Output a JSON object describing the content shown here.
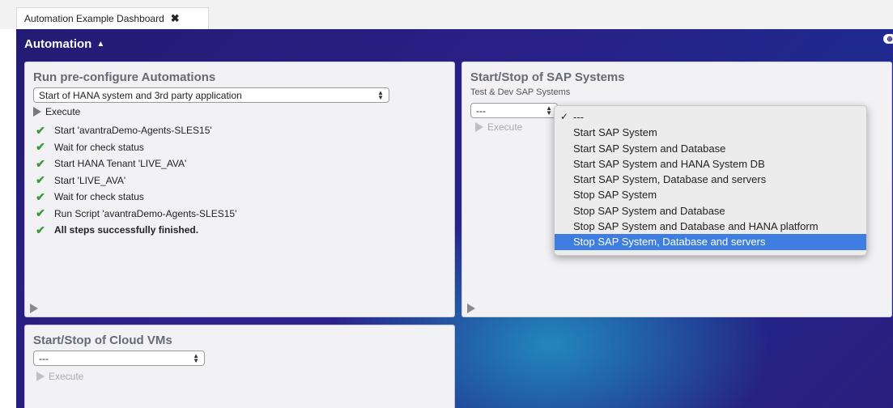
{
  "tab": {
    "title": "Automation Example Dashboard",
    "close_glyph": "✖"
  },
  "dashboard": {
    "title": "Automation",
    "caret": "▲",
    "corner_icon": "gamepad-icon"
  },
  "panel_automations": {
    "title": "Run pre-configure Automations",
    "select_value": "Start of HANA system and 3rd party application",
    "execute_label": "Execute",
    "steps": [
      "Start 'avantraDemo-Agents-SLES15'",
      "Wait for check status",
      "Start HANA Tenant 'LIVE_AVA'",
      "Start 'LIVE_AVA'",
      "Wait for check status",
      "Run Script 'avantraDemo-Agents-SLES15'",
      "All steps successfully finished."
    ],
    "check_glyph": "✔"
  },
  "panel_sap": {
    "title": "Start/Stop of SAP Systems",
    "sublabel": "Test & Dev SAP Systems",
    "select_value": "---",
    "execute_label": "Execute"
  },
  "panel_cloud": {
    "title": "Start/Stop of Cloud VMs",
    "select_value": "---",
    "execute_label": "Execute"
  },
  "dropdown": {
    "selected_tick": "✓",
    "options": [
      "---",
      "Start SAP System",
      "Start SAP System and Database",
      "Start SAP System and HANA System DB",
      "Start SAP System, Database and servers",
      "Stop SAP System",
      "Stop SAP System and Database",
      "Stop SAP System and Database and HANA platform",
      "Stop SAP System, Database and servers"
    ],
    "highlighted_index": 8
  },
  "colors": {
    "dashboard_bg": "#231b73",
    "accent_teal": "#238cbe",
    "highlight": "#3d7ee0",
    "check": "#3a9a3a"
  }
}
